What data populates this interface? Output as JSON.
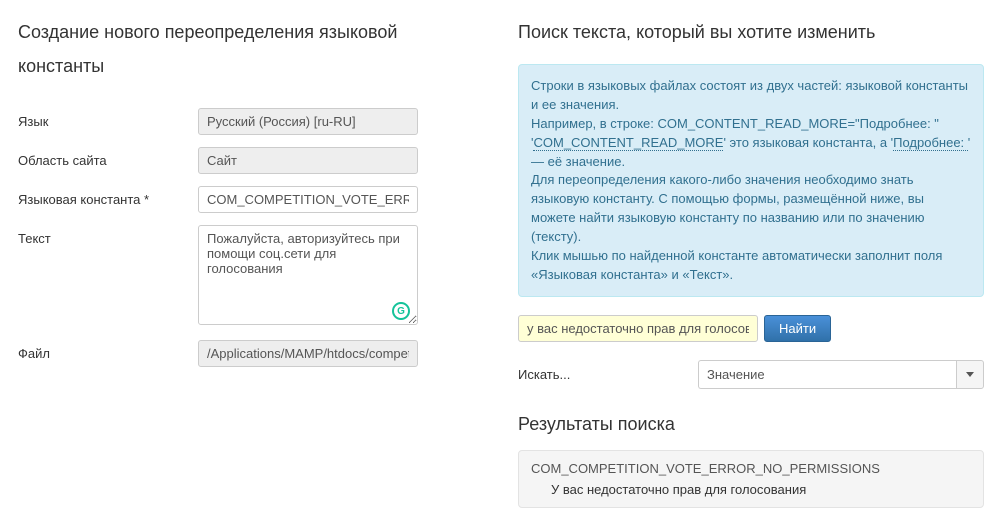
{
  "left": {
    "heading": "Создание нового переопределения языковой константы",
    "labels": {
      "language": "Язык",
      "location": "Область сайта",
      "constant": "Языковая константа *",
      "text": "Текст",
      "file": "Файл"
    },
    "values": {
      "language": "Русский (Россия) [ru-RU]",
      "location": "Сайт",
      "constant": "COM_COMPETITION_VOTE_ERROR_NO_PERMISSIONS",
      "text": "Пожалуйста, авторизуйтесь при помощи соц.сети для голосования",
      "file": "/Applications/MAMP/htdocs/competition"
    }
  },
  "right": {
    "heading": "Поиск текста, который вы хотите изменить",
    "info": {
      "line1": "Строки в языковых файлах состоят из двух частей: языковой константы и ее значения.",
      "line2a": "Например, в строке: COM_CONTENT_READ_MORE=\"Подробнее: \"",
      "line2b_pre": "'",
      "line2b_const": "COM_CONTENT_READ_MORE",
      "line2b_mid": "' это языковая константа, а '",
      "line2b_val": "Подробнее: ",
      "line2b_post": "' — её значение.",
      "line3": "Для переопределения какого-либо значения необходимо знать языковую константу. С помощью формы, размещённой ниже, вы можете найти языковую константу по названию или по значению (тексту).",
      "line4": "Клик мышью по найденной константе автоматически заполнит поля «Языковая константа» и «Текст»."
    },
    "search": {
      "value": "у вас недостаточно прав для голосования",
      "button": "Найти"
    },
    "select": {
      "label": "Искать...",
      "value": "Значение"
    },
    "results": {
      "heading": "Результаты поиска",
      "items": [
        {
          "const": "COM_COMPETITION_VOTE_ERROR_NO_PERMISSIONS",
          "value": "У вас недостаточно прав для голосования"
        }
      ]
    }
  }
}
